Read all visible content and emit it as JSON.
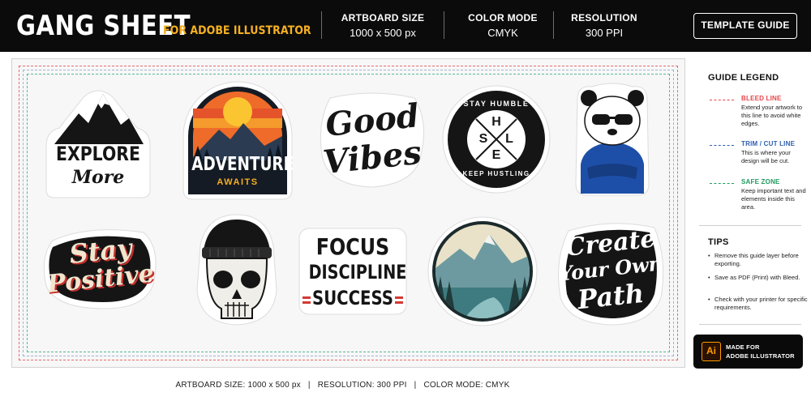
{
  "header": {
    "title": "GANG SHEET",
    "subtitle": "FOR ADOBE ILLUSTRATOR",
    "stats": [
      {
        "label": "ARTBOARD SIZE",
        "value": "1000 x 500 px"
      },
      {
        "label": "COLOR MODE",
        "value": "CMYK"
      },
      {
        "label": "RESOLUTION",
        "value": "300 PPI"
      }
    ],
    "template_guide_label": "TEMPLATE GUIDE"
  },
  "stickers": {
    "explore": {
      "line1": "EXPLORE",
      "line2": "More"
    },
    "adventure": {
      "line1": "ADVENTURE",
      "line2": "AWAITS"
    },
    "good_vibes": {
      "line1": "Good",
      "line2": "Vibes"
    },
    "stay_humble": {
      "top": "STAY HUMBLE",
      "bottom": "KEEP HUSTLING",
      "l1": "S",
      "l2": "H",
      "l3": "L",
      "l4": "E"
    },
    "panda": {},
    "stay_positive": {
      "line1": "Stay",
      "line2": "Positive"
    },
    "skull": {},
    "focus": {
      "line1": "FOCUS",
      "line2": "DISCIPLINE",
      "line3": "SUCCESS"
    },
    "lake": {},
    "create_path": {
      "line1": "Create",
      "line2": "Your Own",
      "line3": "Path"
    }
  },
  "legend": {
    "title": "GUIDE LEGEND",
    "items": [
      {
        "title": "BLEED LINE",
        "desc": "Extend your artwork to this line to avoid white edges.",
        "color": "#e8454a"
      },
      {
        "title": "TRIM / CUT LINE",
        "desc": "This is where your design will be cut.",
        "color": "#2f5fb0"
      },
      {
        "title": "SAFE ZONE",
        "desc": "Keep important text and elements inside this area.",
        "color": "#1f9a5e"
      }
    ]
  },
  "tips": {
    "title": "TIPS",
    "items": [
      "Remove this guide layer before exporting.",
      "Save as PDF (Print) with Bleed.",
      "Check with your printer for specific requirements."
    ]
  },
  "badge": {
    "logo": "Ai",
    "line1": "MADE FOR",
    "line2": "ADOBE ILLUSTRATOR",
    "accent": "#ff9a00"
  },
  "footer": {
    "artboard": "ARTBOARD SIZE: 1000 x 500 px",
    "resolution": "RESOLUTION: 300 PPI",
    "color_mode": "COLOR MODE: CMYK",
    "separator": "|"
  },
  "colors": {
    "header_bg": "#0b0b0b",
    "subtitle": "#f5b021",
    "bleed": "#e8696a",
    "trim": "#9fb4cf",
    "safe": "#57b79a"
  }
}
